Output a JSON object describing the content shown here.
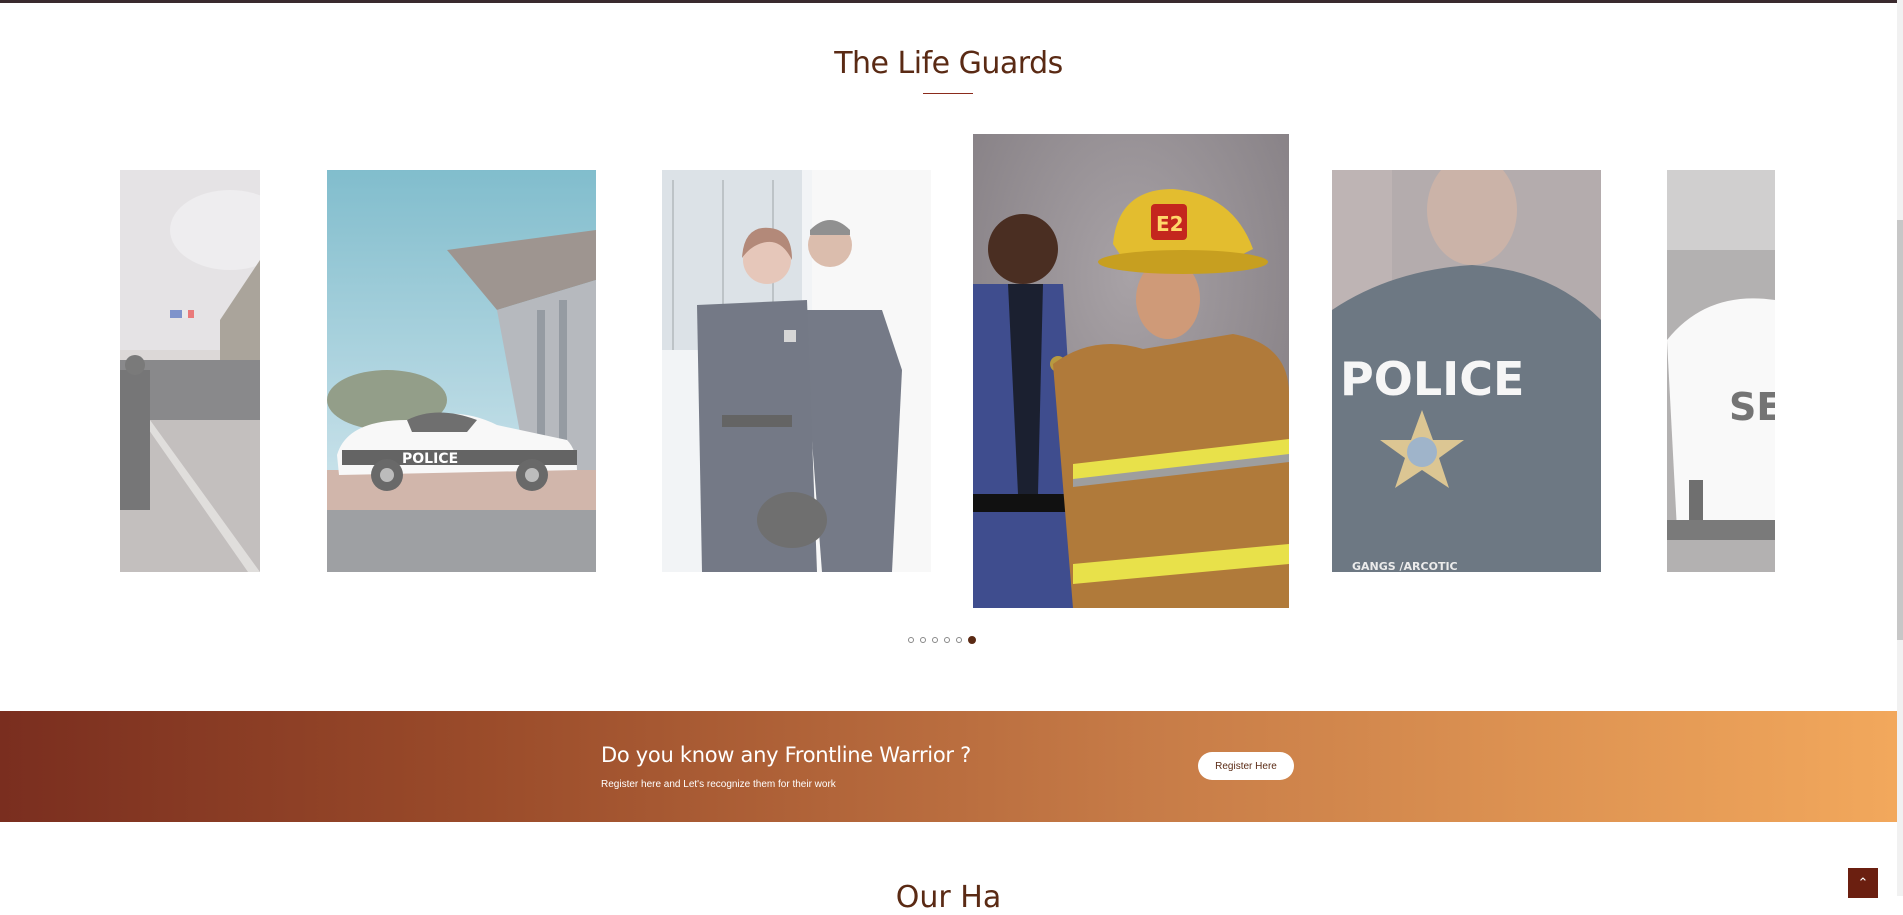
{
  "section": {
    "title": "The Life Guards"
  },
  "carousel": {
    "slides": [
      {
        "name": "slide-street-parade",
        "alt": "Crowd on boulevard"
      },
      {
        "name": "slide-police-car",
        "alt": "Police car"
      },
      {
        "name": "slide-police-officers",
        "alt": "Police officers"
      },
      {
        "name": "slide-officer-firefighter",
        "alt": "Officer and firefighter",
        "helmet_text": "E2"
      },
      {
        "name": "slide-police-back",
        "alt": "Police shirt back",
        "shirt_text": "POLICE",
        "sub_text": "GANGS /ARCOTIC"
      },
      {
        "name": "slide-security",
        "alt": "Security shirt",
        "shirt_text": "SEC"
      }
    ],
    "car_text": "POLICE",
    "dots_count": 6,
    "active_dot": 6
  },
  "banner": {
    "title": "Do you know any Frontline Warrior ?",
    "subtitle": "Register here and Let's recognize them for their work",
    "button_label": "Register Here"
  },
  "next_section": {
    "title": "Our Ha"
  },
  "back_to_top": {
    "icon": "chevron-up-icon",
    "glyph": "⌃"
  },
  "colors": {
    "accent": "#5a2a14",
    "banner_start": "#7a2e1f",
    "banner_end": "#f2a85c"
  }
}
